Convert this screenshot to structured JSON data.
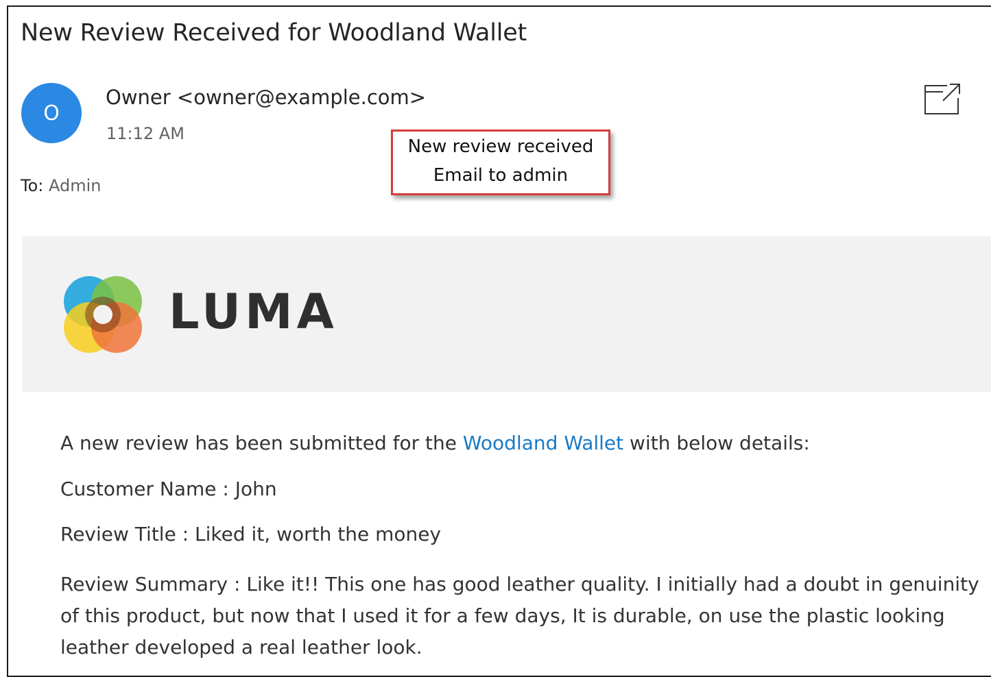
{
  "email": {
    "subject": "New Review Received for Woodland Wallet",
    "avatar_initial": "O",
    "sender": "Owner <owner@example.com>",
    "time": "11:12 AM",
    "to_label": "To:",
    "to_value": "Admin",
    "popout_icon": "open-in-new-window-icon"
  },
  "callout": {
    "line1": "New review received",
    "line2": "Email to admin",
    "border_color": "#d43c3c"
  },
  "banner": {
    "logo_text": "LUMA",
    "logo_icon": "luma-logo-icon"
  },
  "body": {
    "intro_before": "A new review has been submitted for the ",
    "product_link": "Woodland Wallet",
    "intro_after": " with below details:",
    "customer_name": "Customer Name : John",
    "review_title": "Review Title : Liked it, worth the money",
    "review_summary": "Review Summary : Like it!! This one has good leather quality. I initially had a doubt in genuinity of this product, but now that I used it for a few days, It is durable, on use the plastic looking leather developed a real leather look."
  },
  "colors": {
    "avatar": "#2b88e3",
    "link": "#1979c3",
    "banner_bg": "#f2f2f2"
  }
}
